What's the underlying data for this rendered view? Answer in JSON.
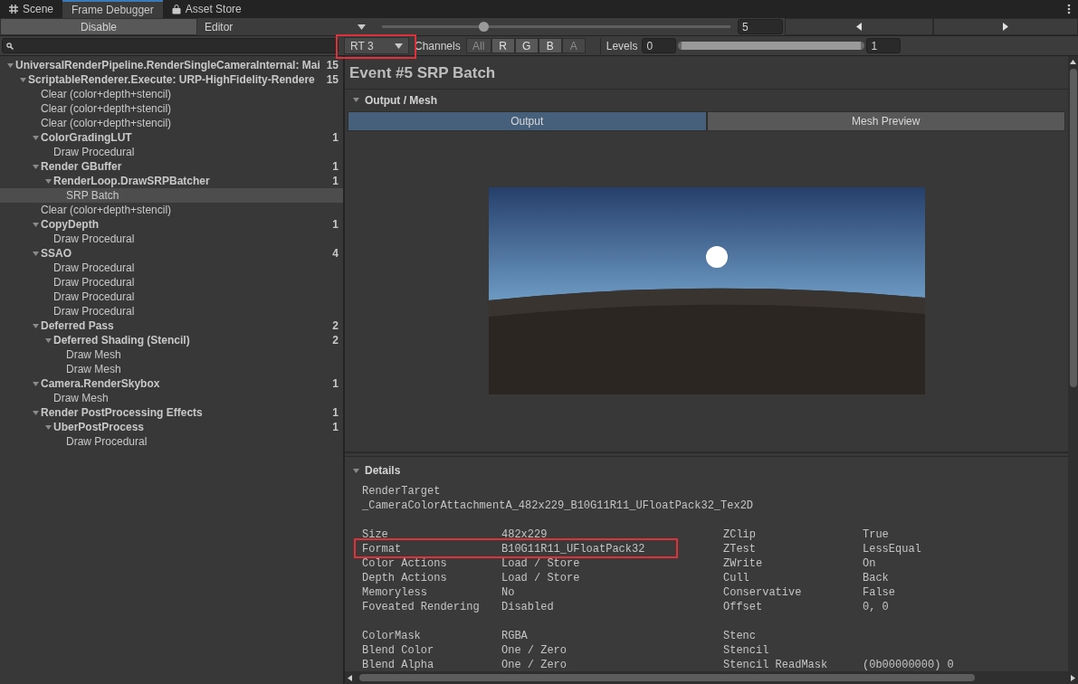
{
  "tabs": [
    {
      "label": "Scene",
      "selected": false
    },
    {
      "label": "Frame Debugger",
      "selected": true
    },
    {
      "label": "Asset Store",
      "selected": false
    }
  ],
  "toolbar": {
    "disable_button": "Disable",
    "source_dropdown": "Editor",
    "event_slider": {
      "level": 0.29
    },
    "event_field": "5"
  },
  "filter_bar": {
    "rt_dropdown": {
      "value": "RT 3",
      "highlighted": true
    },
    "channels_label": "Channels",
    "channels": [
      {
        "label": "All",
        "disabled": true
      },
      {
        "label": "R",
        "disabled": false
      },
      {
        "label": "G",
        "disabled": false
      },
      {
        "label": "B",
        "disabled": false
      },
      {
        "label": "A",
        "disabled": true
      }
    ],
    "levels_label": "Levels",
    "levels_min": "0",
    "levels_max": "1"
  },
  "tree": [
    {
      "label": "UniversalRenderPipeline.RenderSingleCameraInternal: Mai",
      "count": "15",
      "expanded": true,
      "selected": false,
      "children": [
        {
          "label": "ScriptableRenderer.Execute: URP-HighFidelity-Rendere",
          "count": "15",
          "expanded": true,
          "selected": false,
          "children": [
            {
              "label": "Clear (color+depth+stencil)",
              "selected": false
            },
            {
              "label": "Clear (color+depth+stencil)",
              "selected": false
            },
            {
              "label": "Clear (color+depth+stencil)",
              "selected": false
            },
            {
              "label": "ColorGradingLUT",
              "count": "1",
              "expanded": true,
              "selected": false,
              "children": [
                {
                  "label": "Draw Procedural",
                  "selected": false
                }
              ]
            },
            {
              "label": "Render GBuffer",
              "count": "1",
              "expanded": true,
              "selected": false,
              "children": [
                {
                  "label": "RenderLoop.DrawSRPBatcher",
                  "count": "1",
                  "expanded": true,
                  "selected": false,
                  "children": [
                    {
                      "label": "SRP Batch",
                      "selected": true
                    }
                  ]
                }
              ]
            },
            {
              "label": "Clear (color+depth+stencil)",
              "selected": false
            },
            {
              "label": "CopyDepth",
              "count": "1",
              "expanded": true,
              "selected": false,
              "children": [
                {
                  "label": "Draw Procedural",
                  "selected": false
                }
              ]
            },
            {
              "label": "SSAO",
              "count": "4",
              "expanded": true,
              "selected": false,
              "children": [
                {
                  "label": "Draw Procedural",
                  "selected": false
                },
                {
                  "label": "Draw Procedural",
                  "selected": false
                },
                {
                  "label": "Draw Procedural",
                  "selected": false
                },
                {
                  "label": "Draw Procedural",
                  "selected": false
                }
              ]
            },
            {
              "label": "Deferred Pass",
              "count": "2",
              "expanded": true,
              "selected": false,
              "children": [
                {
                  "label": "Deferred Shading (Stencil)",
                  "count": "2",
                  "expanded": true,
                  "selected": false,
                  "children": [
                    {
                      "label": "Draw Mesh",
                      "selected": false
                    },
                    {
                      "label": "Draw Mesh",
                      "selected": false
                    }
                  ]
                }
              ]
            },
            {
              "label": "Camera.RenderSkybox",
              "count": "1",
              "expanded": true,
              "selected": false,
              "children": [
                {
                  "label": "Draw Mesh",
                  "selected": false
                }
              ]
            },
            {
              "label": "Render PostProcessing Effects",
              "count": "1",
              "expanded": true,
              "selected": false,
              "children": [
                {
                  "label": "UberPostProcess",
                  "count": "1",
                  "expanded": true,
                  "selected": false,
                  "children": [
                    {
                      "label": "Draw Procedural",
                      "selected": false
                    }
                  ]
                }
              ]
            }
          ]
        }
      ]
    }
  ],
  "event_title": "Event #5 SRP Batch",
  "output_section": {
    "title": "Output / Mesh",
    "expanded": true,
    "tabs": [
      {
        "label": "Output",
        "selected": true
      },
      {
        "label": "Mesh Preview",
        "selected": false
      }
    ]
  },
  "details": {
    "title": "Details",
    "expanded": true,
    "render_target_label": "RenderTarget",
    "render_target": "_CameraColorAttachmentA_482x229_B10G11R11_UFloatPack32_Tex2D",
    "groups": [
      [
        {
          "label": "Size",
          "value": "482x229",
          "side_label": "ZClip",
          "side_value": "True",
          "highlighted": false
        },
        {
          "label": "Format",
          "value": "B10G11R11_UFloatPack32",
          "side_label": "ZTest",
          "side_value": "LessEqual",
          "highlighted": true
        },
        {
          "label": "Color Actions",
          "value": "Load / Store",
          "side_label": "ZWrite",
          "side_value": "On",
          "highlighted": false
        },
        {
          "label": "Depth Actions",
          "value": "Load / Store",
          "side_label": "Cull",
          "side_value": "Back",
          "highlighted": false
        },
        {
          "label": "Memoryless",
          "value": "No",
          "side_label": "Conservative",
          "side_value": "False",
          "highlighted": false
        },
        {
          "label": "Foveated Rendering",
          "value": "Disabled",
          "side_label": "Offset",
          "side_value": "0, 0",
          "highlighted": false
        }
      ],
      [
        {
          "label": "ColorMask",
          "value": "RGBA",
          "side_label": "Stenc",
          "highlighted": false
        },
        {
          "label": "Blend Color",
          "value": "One / Zero",
          "side_label": "Stencil",
          "highlighted": false
        },
        {
          "label": "Blend Alpha",
          "value": "One / Zero",
          "side_label": "Stencil ReadMask",
          "side_value": "(0b00000000) 0",
          "highlighted": false
        }
      ]
    ]
  }
}
